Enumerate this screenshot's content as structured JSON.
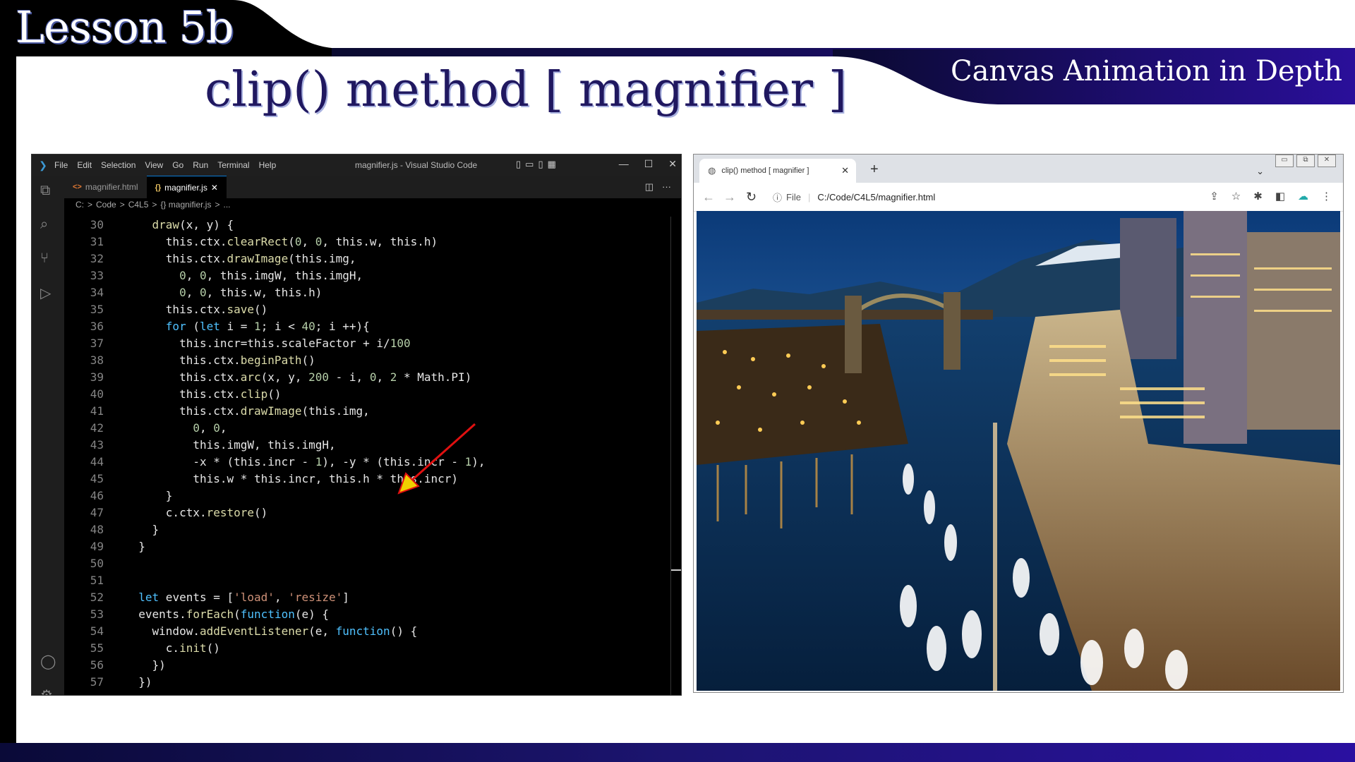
{
  "slide": {
    "lesson": "Lesson 5b",
    "subtitle": "Canvas Animation in Depth",
    "title": "clip() method [ magnifier ]"
  },
  "vscode": {
    "menu": [
      "File",
      "Edit",
      "Selection",
      "View",
      "Go",
      "Run",
      "Terminal",
      "Help"
    ],
    "window_title": "magnifier.js - Visual Studio Code",
    "tabs": [
      {
        "label": "magnifier.html",
        "active": false
      },
      {
        "label": "magnifier.js",
        "active": true
      }
    ],
    "breadcrumb": [
      "C:",
      ">",
      "Code",
      ">",
      "C4L5",
      ">",
      "{} magnifier.js",
      ">",
      "..."
    ],
    "lines": [
      {
        "n": "30",
        "code": "    draw(x, y) {"
      },
      {
        "n": "31",
        "code": "      this.ctx.clearRect(0, 0, this.w, this.h)"
      },
      {
        "n": "32",
        "code": "      this.ctx.drawImage(this.img,"
      },
      {
        "n": "33",
        "code": "        0, 0, this.imgW, this.imgH,"
      },
      {
        "n": "34",
        "code": "        0, 0, this.w, this.h)"
      },
      {
        "n": "35",
        "code": "      this.ctx.save()"
      },
      {
        "n": "36",
        "code": "      for (let i = 1; i < 40; i ++){"
      },
      {
        "n": "37",
        "code": "        this.incr=this.scaleFactor + i/100"
      },
      {
        "n": "38",
        "code": "        this.ctx.beginPath()"
      },
      {
        "n": "39",
        "code": "        this.ctx.arc(x, y, 200 - i, 0, 2 * Math.PI)"
      },
      {
        "n": "40",
        "code": "        this.ctx.clip()"
      },
      {
        "n": "41",
        "code": "        this.ctx.drawImage(this.img,"
      },
      {
        "n": "42",
        "code": "          0, 0,"
      },
      {
        "n": "43",
        "code": "          this.imgW, this.imgH,"
      },
      {
        "n": "44",
        "code": "          -x * (this.incr - 1), -y * (this.incr - 1),"
      },
      {
        "n": "45",
        "code": "          this.w * this.incr, this.h * this.incr)"
      },
      {
        "n": "46",
        "code": "      }"
      },
      {
        "n": "47",
        "code": "      c.ctx.restore()"
      },
      {
        "n": "48",
        "code": "    }"
      },
      {
        "n": "49",
        "code": "  }"
      },
      {
        "n": "50",
        "code": ""
      },
      {
        "n": "51",
        "code": ""
      },
      {
        "n": "52",
        "code": "  let events = ['load', 'resize']"
      },
      {
        "n": "53",
        "code": "  events.forEach(function(e) {"
      },
      {
        "n": "54",
        "code": "    window.addEventListener(e, function() {"
      },
      {
        "n": "55",
        "code": "      c.init()"
      },
      {
        "n": "56",
        "code": "    })"
      },
      {
        "n": "57",
        "code": "  })"
      }
    ]
  },
  "browser": {
    "tab_title": "clip() method [ magnifier ]",
    "scheme_label": "File",
    "url": "C:/Code/C4L5/magnifier.html"
  },
  "icons": {
    "vscode_logo": "vscode-logo-icon",
    "explorer": "files-icon",
    "search": "search-icon",
    "source_control": "source-control-icon",
    "run_debug": "run-debug-icon",
    "accounts": "account-icon",
    "manage": "gear-icon"
  }
}
